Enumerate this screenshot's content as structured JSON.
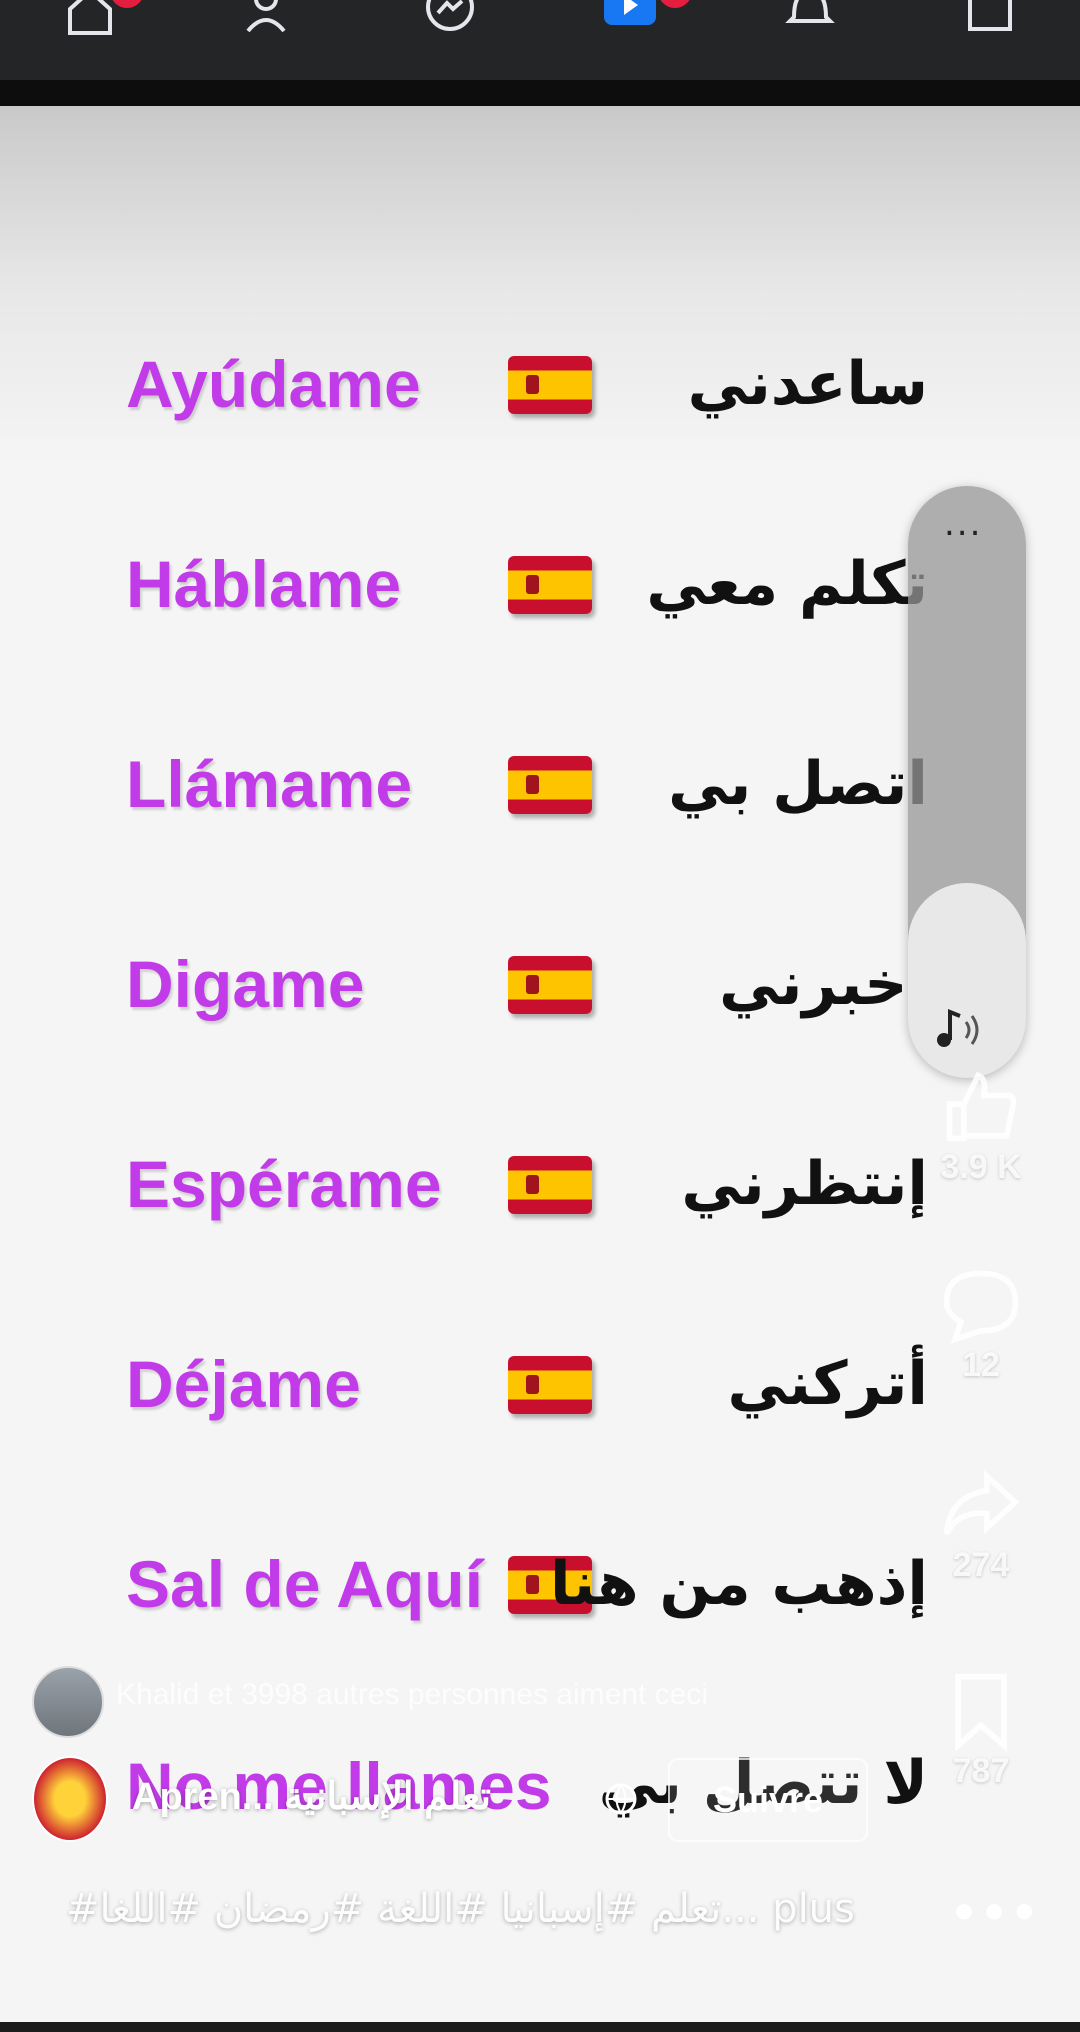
{
  "nav": {
    "items": [
      {
        "name": "home",
        "badge": true
      },
      {
        "name": "friends",
        "badge": false
      },
      {
        "name": "messenger",
        "badge": false
      },
      {
        "name": "video",
        "badge": true
      },
      {
        "name": "notifications",
        "badge": false
      },
      {
        "name": "marketplace",
        "badge": false
      }
    ]
  },
  "rows": [
    {
      "es": "Ayúdame",
      "ar": "ساعدني"
    },
    {
      "es": "Háblame",
      "ar": "تكلم معي"
    },
    {
      "es": "Llámame",
      "ar": "اتصل بي"
    },
    {
      "es": "Digame",
      "ar": "أخبرني"
    },
    {
      "es": "Espérame",
      "ar": "إنتظرني"
    },
    {
      "es": "Déjame",
      "ar": "أتركني"
    },
    {
      "es": "Sal de Aquí",
      "ar": "إذهب من هنا"
    }
  ],
  "last_row": {
    "es": "No me llames",
    "ar": "لا تتصل بي"
  },
  "volume": {
    "dots": "...",
    "level": 0.33
  },
  "actions": {
    "likes": "3.9 K",
    "comments": "12",
    "shares": "274",
    "saves": "787"
  },
  "likers_text": "Khalid et 3998 autres personnes aiment ceci",
  "page_name": "Apren... تعلم الإسبانية",
  "follow_label": "Suivre",
  "caption": "#تعلم #إسبانيا #اللغة #رمضان #اللغا... plus",
  "more_label": "•••",
  "colors": {
    "spanish_word": "#c23be8",
    "nav_bg": "#242526",
    "badge": "#e41e3f",
    "video_active": "#1877f2"
  }
}
